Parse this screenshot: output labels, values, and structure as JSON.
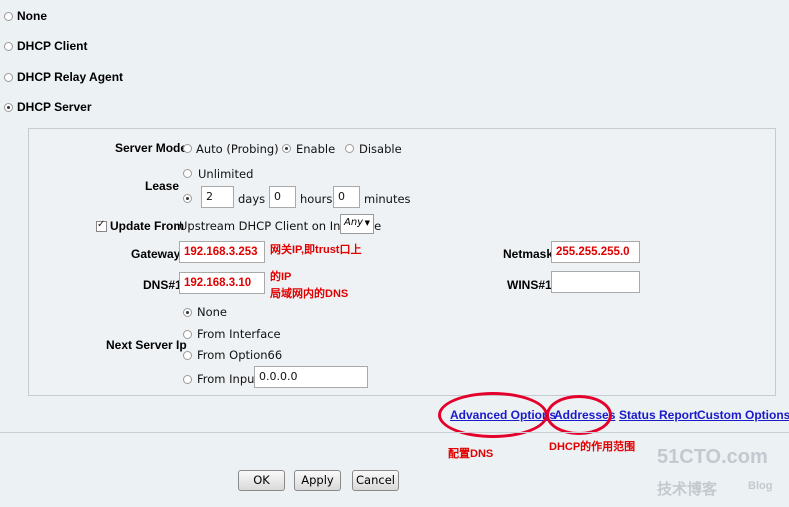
{
  "mode_options": [
    {
      "label": "None",
      "selected": false
    },
    {
      "label": "DHCP Client",
      "selected": false
    },
    {
      "label": "DHCP Relay Agent",
      "selected": false
    },
    {
      "label": "DHCP Server",
      "selected": true
    }
  ],
  "server_mode": {
    "label": "Server Mode",
    "options": [
      {
        "label": "Auto (Probing)",
        "selected": false
      },
      {
        "label": "Enable",
        "selected": true
      },
      {
        "label": "Disable",
        "selected": false
      }
    ]
  },
  "lease": {
    "label": "Lease",
    "unlimited_label": "Unlimited",
    "days_value": "2",
    "days_label": "days",
    "hours_value": "0",
    "hours_label": "hours",
    "minutes_value": "0",
    "minutes_label": "minutes"
  },
  "update_from": {
    "label": "Update From",
    "text": "Upstream DHCP Client on Interface",
    "interface_value": "Any",
    "checked": true
  },
  "gateway": {
    "label": "Gateway",
    "value": "192.168.3.253",
    "note": "网关IP,即trust口上"
  },
  "netmask": {
    "label": "Netmask",
    "value": "255.255.255.0"
  },
  "dns1": {
    "label": "DNS#1",
    "value": "192.168.3.10",
    "note_line1": "的IP",
    "note_line2": "局域网内的DNS"
  },
  "wins1": {
    "label": "WINS#1",
    "value": ""
  },
  "next_server": {
    "label": "Next Server Ip",
    "options": [
      {
        "label": "None",
        "selected": true
      },
      {
        "label": "From Interface",
        "selected": false
      },
      {
        "label": "From Option66",
        "selected": false
      },
      {
        "label": "From Input",
        "selected": false
      }
    ],
    "input_value": "0.0.0.0"
  },
  "links": {
    "advanced_options": "Advanced Options",
    "addresses": "Addresses",
    "status_report": "Status Report",
    "custom_options": "Custom Options"
  },
  "annotations": {
    "advanced_note": "配置DNS",
    "addresses_note": "DHCP的作用范围"
  },
  "buttons": {
    "ok": "OK",
    "apply": "Apply",
    "cancel": "Cancel"
  },
  "watermark": {
    "line1": "51CTO.com",
    "line2": "技术博客",
    "line3": "Blog"
  },
  "colors": {
    "annotation_red": "#e00000",
    "link_blue": "#1a1acc",
    "ellipse_red": "#e4002b"
  }
}
